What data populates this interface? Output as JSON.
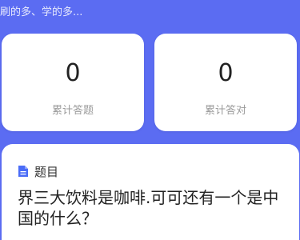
{
  "header": {
    "tagline": "刷的多、学的多..."
  },
  "stats": [
    {
      "value": "0",
      "label": "累计答题"
    },
    {
      "value": "0",
      "label": "累计答对"
    }
  ],
  "question": {
    "section_label": "题目",
    "icon": "document-icon",
    "text": "界三大饮料是咖啡.可可还有一个是中国的什么？"
  },
  "colors": {
    "background": "#5b6cf2",
    "card": "#ffffff",
    "icon_accent": "#4a6cf7"
  }
}
